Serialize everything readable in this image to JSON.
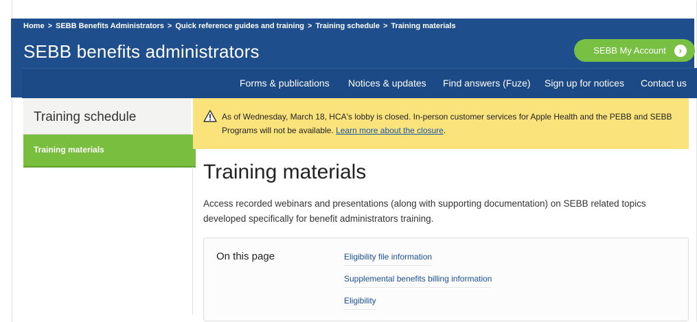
{
  "breadcrumb": [
    "Home",
    "SEBB Benefits Administrators",
    "Quick reference guides and training",
    "Training schedule",
    "Training materials"
  ],
  "breadcrumb_sep": ">",
  "site_title": "SEBB benefits administrators",
  "account_button": {
    "label": "SEBB My Account",
    "icon": "arrow-right-circle-icon"
  },
  "nav": [
    "Forms & publications",
    "Notices & updates",
    "Find answers (Fuze)",
    "Sign up for notices",
    "Contact us"
  ],
  "sidebar": {
    "title": "Training schedule",
    "active_item": "Training materials"
  },
  "alert": {
    "icon": "warning-icon",
    "text": "As of Wednesday, March 18, HCA's lobby is closed. In-person customer services for Apple Health and the PEBB and SEBB Programs will not be available. ",
    "link": "Learn more about the closure",
    "after_link": "."
  },
  "page": {
    "title": "Training materials",
    "intro": "Access recorded webinars and presentations (along with supporting documentation) on SEBB related topics developed specifically for benefit administrators training."
  },
  "on_this_page": {
    "label": "On this page",
    "links": [
      "Eligibility file information",
      "Supplemental benefits billing information",
      "Eligibility"
    ]
  },
  "colors": {
    "header_blue": "#1f4e8c",
    "accent_green": "#78c043",
    "alert_yellow": "#fbe37c",
    "link_blue": "#1a4f98"
  }
}
